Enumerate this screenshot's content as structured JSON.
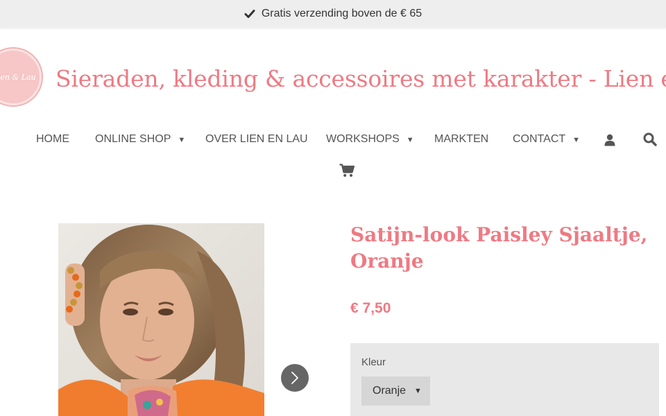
{
  "announcement": {
    "text": "Gratis verzending boven de € 65",
    "icon": "check-icon"
  },
  "logo": {
    "text": "en & Lau"
  },
  "site": {
    "title": "Sieraden, kleding & accessoires met karakter - Lien en"
  },
  "nav": {
    "items": [
      {
        "label": "HOME",
        "has_dropdown": false
      },
      {
        "label": "ONLINE SHOP",
        "has_dropdown": true
      },
      {
        "label": "OVER LIEN EN LAU",
        "has_dropdown": false
      },
      {
        "label": "WORKSHOPS",
        "has_dropdown": true
      },
      {
        "label": "MARKTEN",
        "has_dropdown": false
      },
      {
        "label": "CONTACT",
        "has_dropdown": true
      }
    ],
    "caret": "▼",
    "icons": [
      "user-icon",
      "search-icon",
      "cart-icon"
    ]
  },
  "product": {
    "title": "Satijn-look Paisley Sjaaltje, Oranje",
    "price": "€ 7,50",
    "option": {
      "label": "Kleur",
      "selected": "Oranje",
      "caret": "▼"
    }
  },
  "colors": {
    "accent": "#ee7a83",
    "topbar_bg": "#eeeeee",
    "nav_text": "#555555",
    "panel_bg": "#e8e8e8",
    "select_bg": "#d6d6d6",
    "carousel_button": "#666666"
  }
}
